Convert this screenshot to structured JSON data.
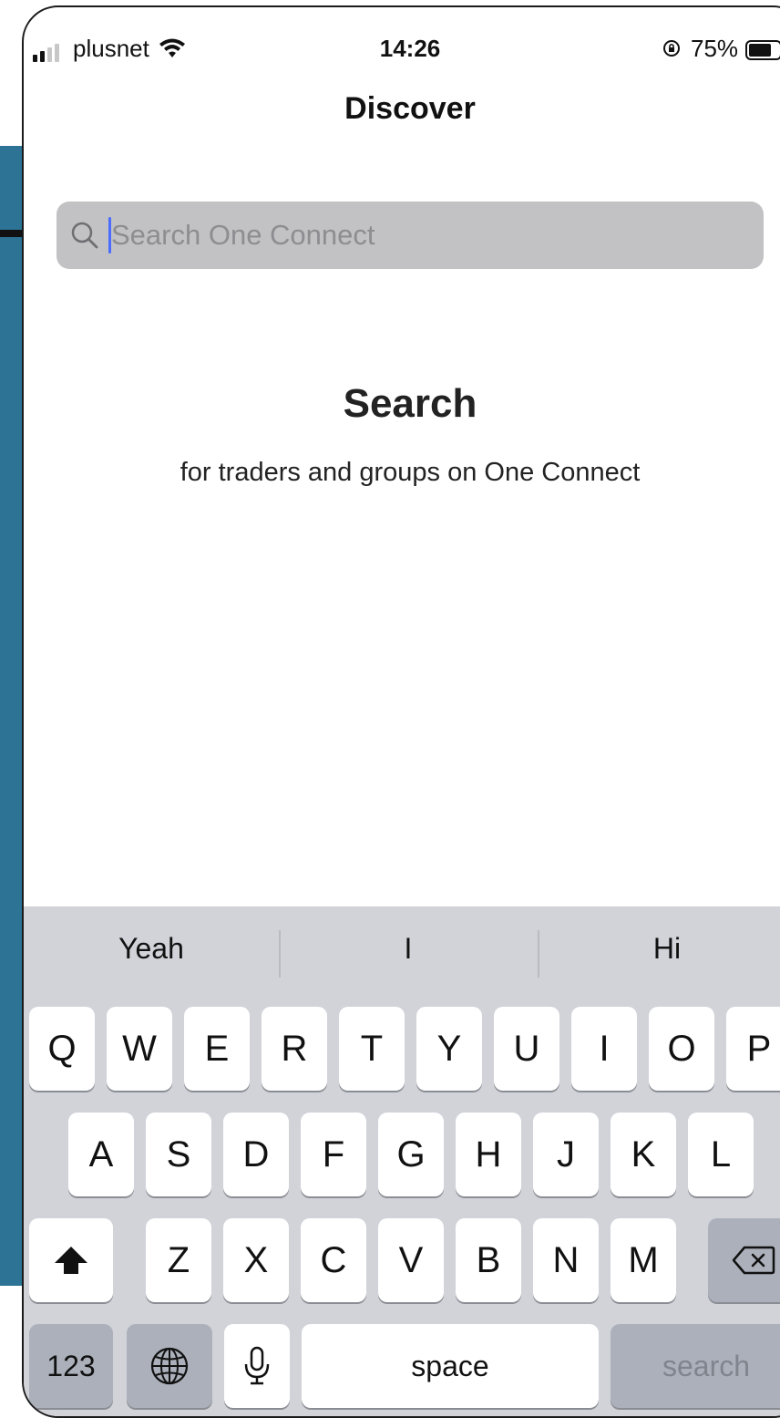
{
  "status_bar": {
    "carrier": "plusnet",
    "time": "14:26",
    "battery_percent": "75%",
    "battery_level": 0.75
  },
  "header": {
    "title": "Discover"
  },
  "search": {
    "placeholder": "Search One Connect",
    "value": ""
  },
  "empty_state": {
    "title": "Search",
    "subtitle": "for traders and groups on One Connect"
  },
  "keyboard": {
    "suggestions": [
      "Yeah",
      "I",
      "Hi"
    ],
    "row1": [
      "Q",
      "W",
      "E",
      "R",
      "T",
      "Y",
      "U",
      "I",
      "O",
      "P"
    ],
    "row2": [
      "A",
      "S",
      "D",
      "F",
      "G",
      "H",
      "J",
      "K",
      "L"
    ],
    "row3": [
      "Z",
      "X",
      "C",
      "V",
      "B",
      "N",
      "M"
    ],
    "numbers_label": "123",
    "space_label": "space",
    "return_label": "search"
  },
  "colors": {
    "side_band": "#2d7396",
    "search_field_bg": "#c2c2c4",
    "caret": "#4a6cff",
    "keyboard_bg": "#d1d3d9"
  }
}
